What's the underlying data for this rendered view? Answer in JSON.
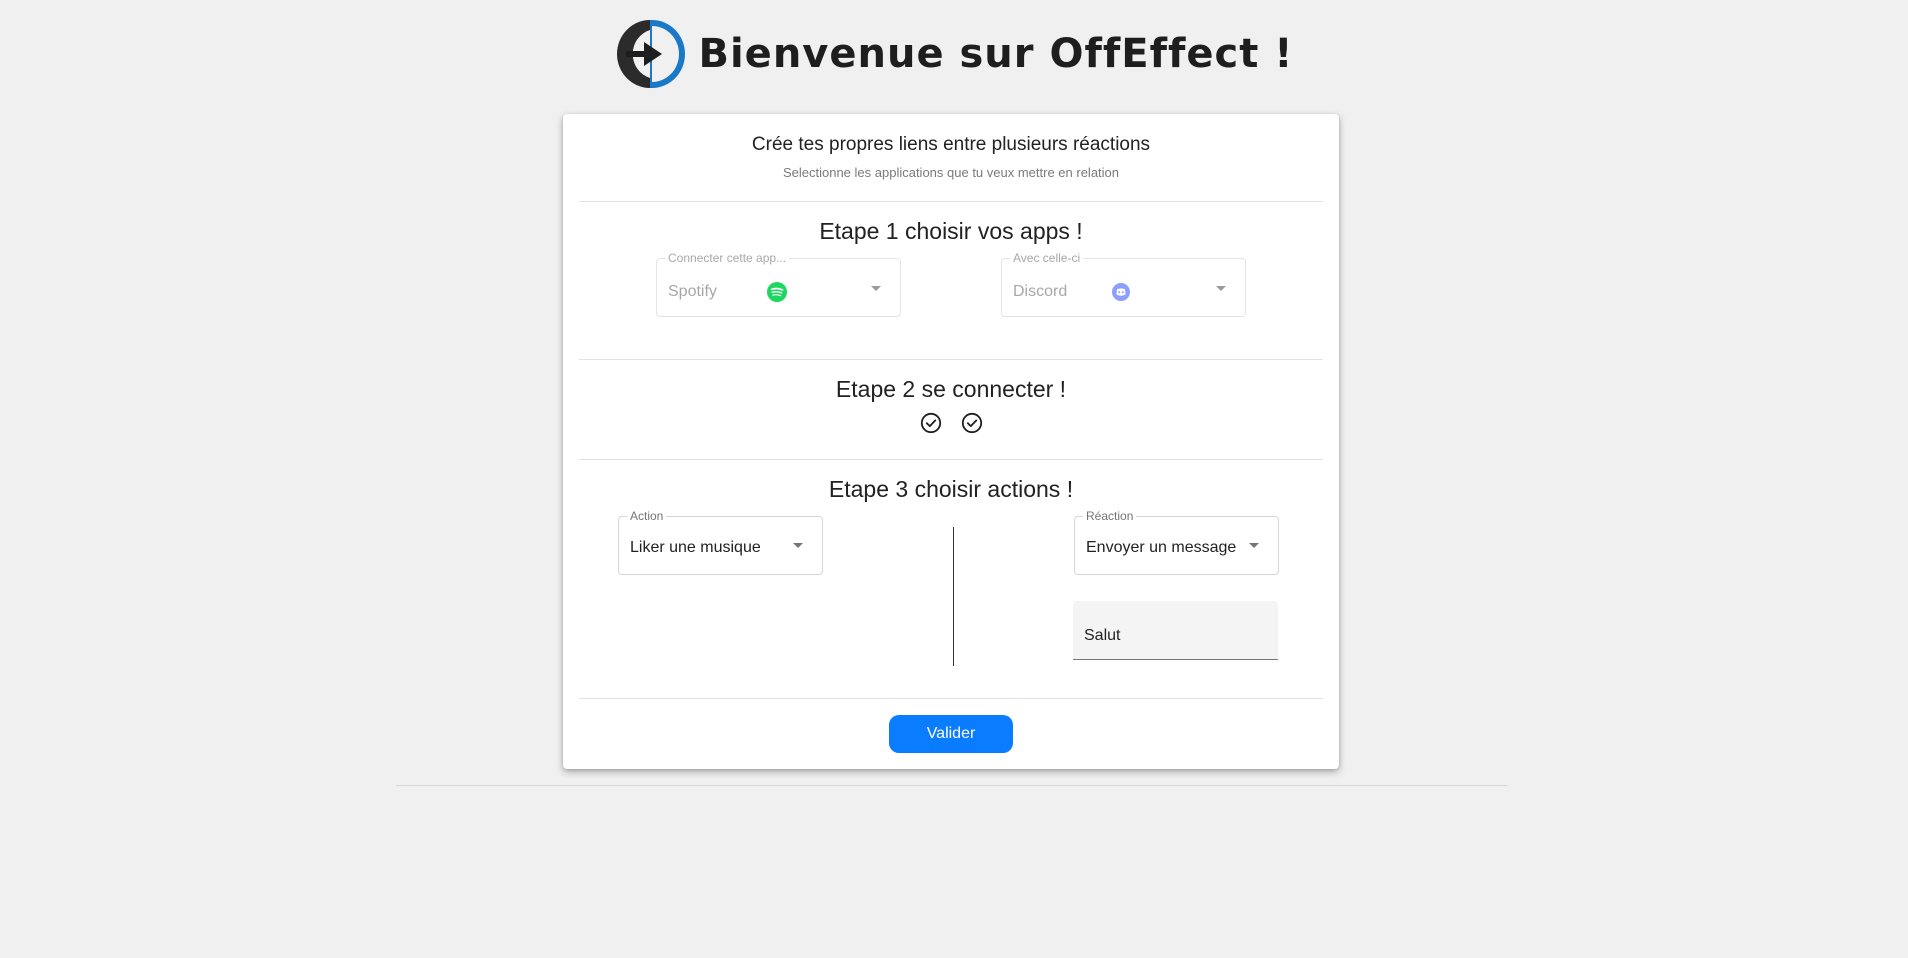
{
  "header": {
    "title": "Bienvenue sur OffEffect !",
    "logo_icon": "offeffect-logo-icon",
    "colors": {
      "logo_blue": "#1a78c8",
      "logo_dark": "#2b2b2b"
    }
  },
  "card": {
    "title": "Crée tes propres liens entre plusieurs réactions",
    "subtitle": "Selectionne les applications que tu veux mettre en relation"
  },
  "step1": {
    "title": "Etape 1 choisir vos apps !",
    "first_app": {
      "label": "Connecter cette app...",
      "value": "Spotify",
      "icon": "spotify-icon",
      "icon_color": "#1ed760"
    },
    "second_app": {
      "label": "Avec celle-ci",
      "value": "Discord",
      "icon": "discord-icon",
      "icon_color": "#7289da"
    }
  },
  "step2": {
    "title": "Etape 2 se connecter !",
    "status_icons": [
      "check-circle-icon",
      "check-circle-icon"
    ]
  },
  "step3": {
    "title": "Etape 3 choisir actions !",
    "action": {
      "label": "Action",
      "value": "Liker une musique"
    },
    "reaction": {
      "label": "Réaction",
      "value": "Envoyer un message"
    },
    "message_field": {
      "value": "Salut"
    }
  },
  "submit": {
    "label": "Valider",
    "color": "#0a7cff"
  }
}
